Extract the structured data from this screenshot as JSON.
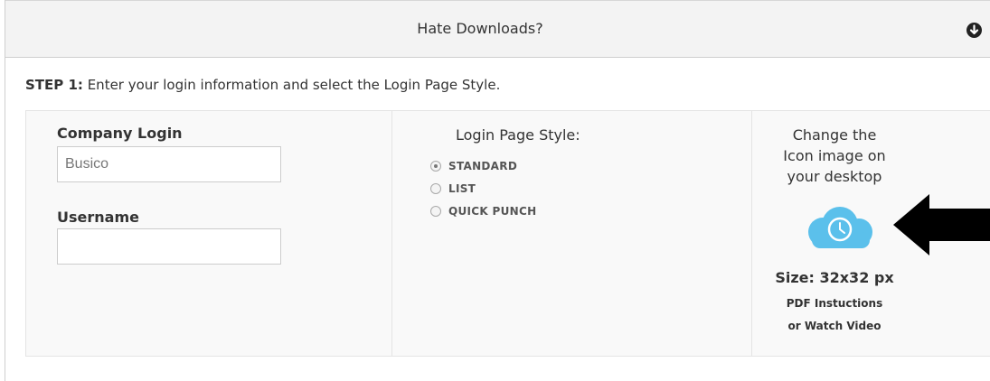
{
  "header": {
    "title": "Hate Downloads?",
    "toggle_icon": "circle-arrow-down-icon"
  },
  "step": {
    "prefix": "STEP 1:",
    "text": " Enter your login information and select the Login Page Style."
  },
  "login": {
    "company_label": "Company Login",
    "company_value": "Busico",
    "username_label": "Username",
    "username_value": ""
  },
  "style": {
    "title": "Login Page Style:",
    "options": [
      {
        "label": "STANDARD",
        "selected": true
      },
      {
        "label": "LIST",
        "selected": false
      },
      {
        "label": "QUICK PUNCH",
        "selected": false
      }
    ]
  },
  "icon_panel": {
    "line1": "Change the",
    "line2": "Icon image on",
    "line3": "your desktop",
    "size_label": "Size: 32x32 px",
    "pdf_link": "PDF Instuctions",
    "video_link": "or Watch Video",
    "cloud_color": "#5bc0eb",
    "arrow_color": "#000000"
  }
}
